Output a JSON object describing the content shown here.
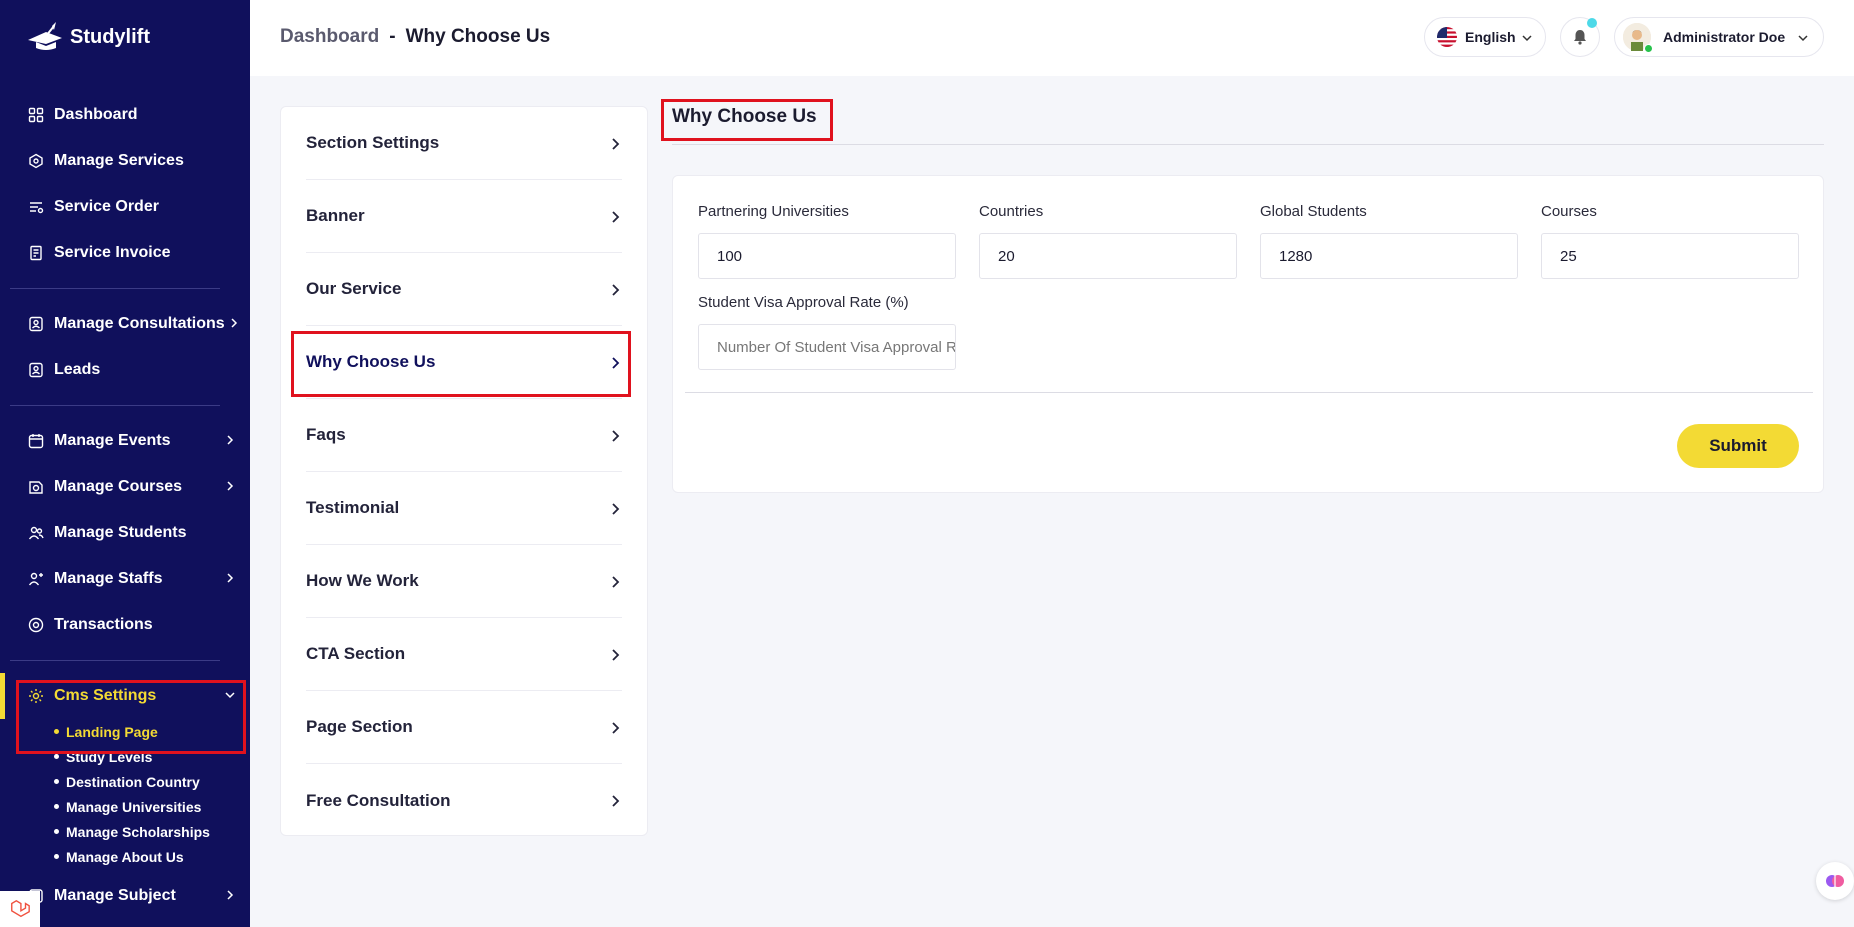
{
  "brand": {
    "name": "Studylift"
  },
  "sidebar": {
    "items": [
      {
        "label": "Dashboard",
        "icon": "grid-icon"
      },
      {
        "label": "Manage Services",
        "icon": "services-icon"
      },
      {
        "label": "Service Order",
        "icon": "order-icon"
      },
      {
        "label": "Service Invoice",
        "icon": "invoice-icon"
      },
      {
        "label": "Manage Consultations",
        "icon": "consultation-icon"
      },
      {
        "label": "Leads",
        "icon": "leads-icon"
      },
      {
        "label": "Manage Events",
        "icon": "calendar-icon"
      },
      {
        "label": "Manage Courses",
        "icon": "courses-icon"
      },
      {
        "label": "Manage Students",
        "icon": "students-icon"
      },
      {
        "label": "Manage Staffs",
        "icon": "staffs-icon"
      },
      {
        "label": "Transactions",
        "icon": "transactions-icon"
      },
      {
        "label": "Cms Settings",
        "icon": "cms-icon"
      },
      {
        "label": "Manage Subject",
        "icon": "subject-icon"
      }
    ],
    "cms_submenu": [
      "Landing Page",
      "Study Levels",
      "Destination Country",
      "Manage Universities",
      "Manage Scholarships",
      "Manage About Us"
    ]
  },
  "header": {
    "breadcrumb_root": "Dashboard",
    "breadcrumb_sep": "-",
    "breadcrumb_current": "Why Choose Us",
    "language": "English",
    "user_name": "Administrator Doe"
  },
  "settings_menu": [
    "Section Settings",
    "Banner",
    "Our Service",
    "Why Choose Us",
    "Faqs",
    "Testimonial",
    "How We Work",
    "CTA Section",
    "Page Section",
    "Free Consultation"
  ],
  "content": {
    "title": "Why Choose Us",
    "fields": {
      "universities": {
        "label": "Partnering Universities",
        "value": "100"
      },
      "countries": {
        "label": "Countries",
        "value": "20"
      },
      "students": {
        "label": "Global Students",
        "value": "1280"
      },
      "courses": {
        "label": "Courses",
        "value": "25"
      },
      "visa": {
        "label": "Student Visa Approval Rate (%)",
        "value": "",
        "placeholder": "Number Of Student Visa Approval Rate"
      }
    },
    "submit_label": "Submit"
  },
  "colors": {
    "sidebar": "#10105c",
    "accent": "#f3da34",
    "highlight": "#e0121e"
  }
}
